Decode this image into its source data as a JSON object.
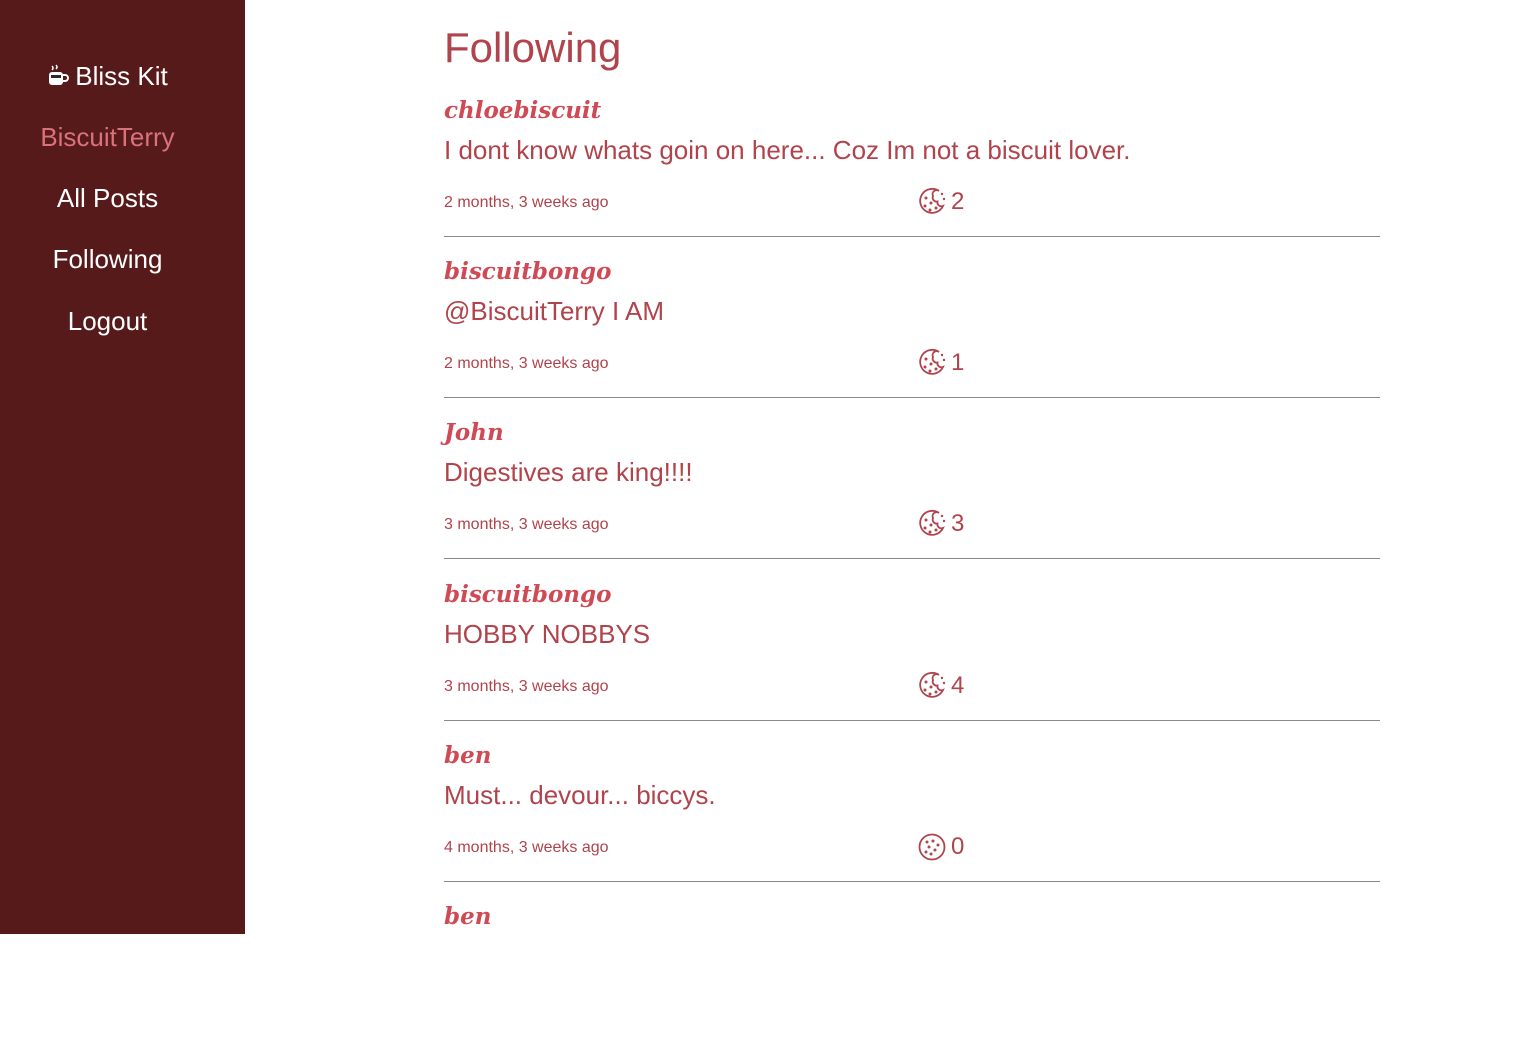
{
  "sidebar": {
    "brand": "Bliss Kit",
    "brand_icon": "coffee-cup-icon",
    "username": "BiscuitTerry",
    "items": [
      {
        "label": "All Posts"
      },
      {
        "label": "Following"
      },
      {
        "label": "Logout"
      }
    ]
  },
  "page_title": "Following",
  "posts": [
    {
      "author": "chloebiscuit",
      "content": "I dont know whats goin on here... Coz Im not a biscuit lover.",
      "time": "2 months, 3 weeks ago",
      "likes": "2",
      "bitten": true
    },
    {
      "author": "biscuitbongo",
      "content": "@BiscuitTerry I AM",
      "time": "2 months, 3 weeks ago",
      "likes": "1",
      "bitten": true
    },
    {
      "author": "John",
      "content": "Digestives are king!!!!",
      "time": "3 months, 3 weeks ago",
      "likes": "3",
      "bitten": true
    },
    {
      "author": "biscuitbongo",
      "content": "HOBBY NOBBYS",
      "time": "3 months, 3 weeks ago",
      "likes": "4",
      "bitten": true
    },
    {
      "author": "ben",
      "content": "Must... devour... biccys.",
      "time": "4 months, 3 weeks ago",
      "likes": "0",
      "bitten": false
    },
    {
      "author": "ben",
      "content": "",
      "time": "",
      "likes": "",
      "bitten": false
    }
  ],
  "colors": {
    "sidebar_bg": "#561a1b",
    "accent": "#b0434b",
    "author": "#cf4a55",
    "username": "#d9727a"
  }
}
